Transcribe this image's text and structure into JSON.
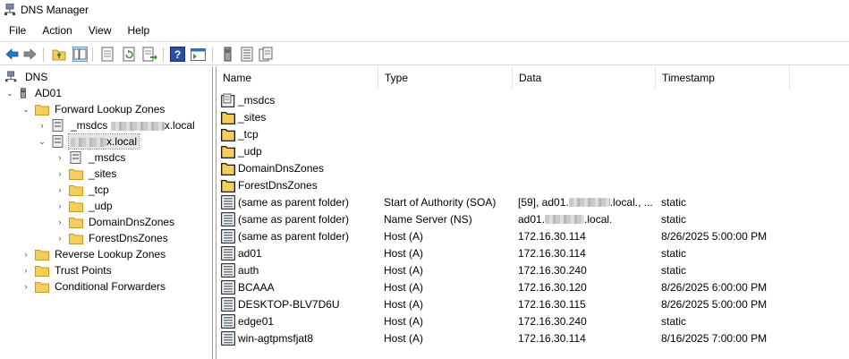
{
  "window": {
    "title": "DNS Manager"
  },
  "menubar": [
    "File",
    "Action",
    "View",
    "Help"
  ],
  "toolbar": {
    "icons": [
      "back-arrow-icon",
      "forward-arrow-icon",
      "up-folder-icon",
      "show-hide-tree-icon",
      "properties-icon",
      "refresh-icon",
      "export-list-icon",
      "help-icon",
      "show-console-tree-icon",
      "server-icon",
      "zone-list-icon",
      "record-copy-icon"
    ]
  },
  "tree": {
    "root": "DNS",
    "server": "AD01",
    "forward_zones": "Forward Lookup Zones",
    "msdcs_zone_prefix": "_msdcs",
    "msdcs_zone_suffix": "x.local",
    "selected_zone_suffix": "x.local",
    "children": [
      "_msdcs",
      "_sites",
      "_tcp",
      "_udp",
      "DomainDnsZones",
      "ForestDnsZones"
    ],
    "reverse_zones": "Reverse Lookup Zones",
    "trust_points": "Trust Points",
    "conditional_forwarders": "Conditional Forwarders"
  },
  "table": {
    "columns": [
      "Name",
      "Type",
      "Data",
      "Timestamp"
    ],
    "rows": [
      {
        "name": "_msdcs",
        "type": "",
        "data": "",
        "timestamp": "",
        "icon": "msdcs-zone-icon"
      },
      {
        "name": "_sites",
        "type": "",
        "data": "",
        "timestamp": "",
        "icon": "folder-icon"
      },
      {
        "name": "_tcp",
        "type": "",
        "data": "",
        "timestamp": "",
        "icon": "folder-icon"
      },
      {
        "name": "_udp",
        "type": "",
        "data": "",
        "timestamp": "",
        "icon": "folder-icon"
      },
      {
        "name": "DomainDnsZones",
        "type": "",
        "data": "",
        "timestamp": "",
        "icon": "folder-icon"
      },
      {
        "name": "ForestDnsZones",
        "type": "",
        "data": "",
        "timestamp": "",
        "icon": "folder-icon"
      },
      {
        "name": "(same as parent folder)",
        "type": "Start of Authority (SOA)",
        "data_prefix": "[59], ad01.",
        "data_suffix": ".local., ...",
        "timestamp": "static",
        "icon": "record-icon"
      },
      {
        "name": "(same as parent folder)",
        "type": "Name Server (NS)",
        "data_prefix": "ad01.",
        "data_suffix": ".local.",
        "timestamp": "static",
        "icon": "record-icon"
      },
      {
        "name": "(same as parent folder)",
        "type": "Host (A)",
        "data": "172.16.30.114",
        "timestamp": "8/26/2025 5:00:00 PM",
        "icon": "record-icon"
      },
      {
        "name": "ad01",
        "type": "Host (A)",
        "data": "172.16.30.114",
        "timestamp": "static",
        "icon": "record-icon"
      },
      {
        "name": "auth",
        "type": "Host (A)",
        "data": "172.16.30.240",
        "timestamp": "static",
        "icon": "record-icon"
      },
      {
        "name": "BCAAA",
        "type": "Host (A)",
        "data": "172.16.30.120",
        "timestamp": "8/26/2025 6:00:00 PM",
        "icon": "record-icon"
      },
      {
        "name": "DESKTOP-BLV7D6U",
        "type": "Host (A)",
        "data": "172.16.30.115",
        "timestamp": "8/26/2025 5:00:00 PM",
        "icon": "record-icon"
      },
      {
        "name": "edge01",
        "type": "Host (A)",
        "data": "172.16.30.240",
        "timestamp": "static",
        "icon": "record-icon"
      },
      {
        "name": "win-agtpmsfjat8",
        "type": "Host (A)",
        "data": "172.16.30.114",
        "timestamp": "8/16/2025 7:00:00 PM",
        "icon": "record-icon"
      }
    ]
  },
  "colors": {
    "folder": "#f4cd5c",
    "folder_border": "#c69a25",
    "back_arrow": "#1e7bd0",
    "help_icon": "#2b4fa8",
    "refresh": "#3a9a3a"
  }
}
